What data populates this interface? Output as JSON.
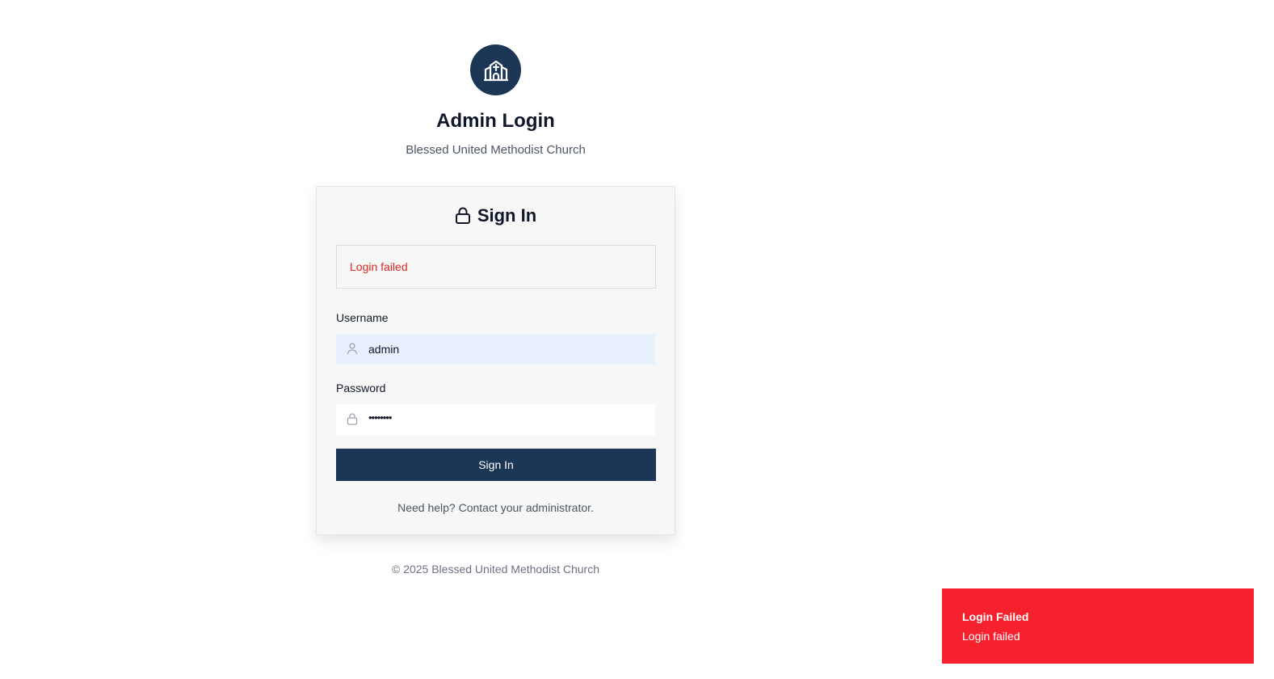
{
  "branding": {
    "logo_icon": "church-icon",
    "title": "Admin Login",
    "subtitle": "Blessed United Methodist Church",
    "accent_color": "#1c3656"
  },
  "card": {
    "title": "Sign In",
    "title_icon": "lock-icon",
    "error_message": "Login failed",
    "username": {
      "label": "Username",
      "value": "admin",
      "icon": "user-icon"
    },
    "password": {
      "label": "Password",
      "masked_value": "••••••••",
      "icon": "lock-icon"
    },
    "submit_label": "Sign In",
    "help_text": "Need help? Contact your administrator."
  },
  "footer": {
    "copyright": "© 2025 Blessed United Methodist Church"
  },
  "toast": {
    "title": "Login Failed",
    "message": "Login failed",
    "color": "#f5222d"
  }
}
